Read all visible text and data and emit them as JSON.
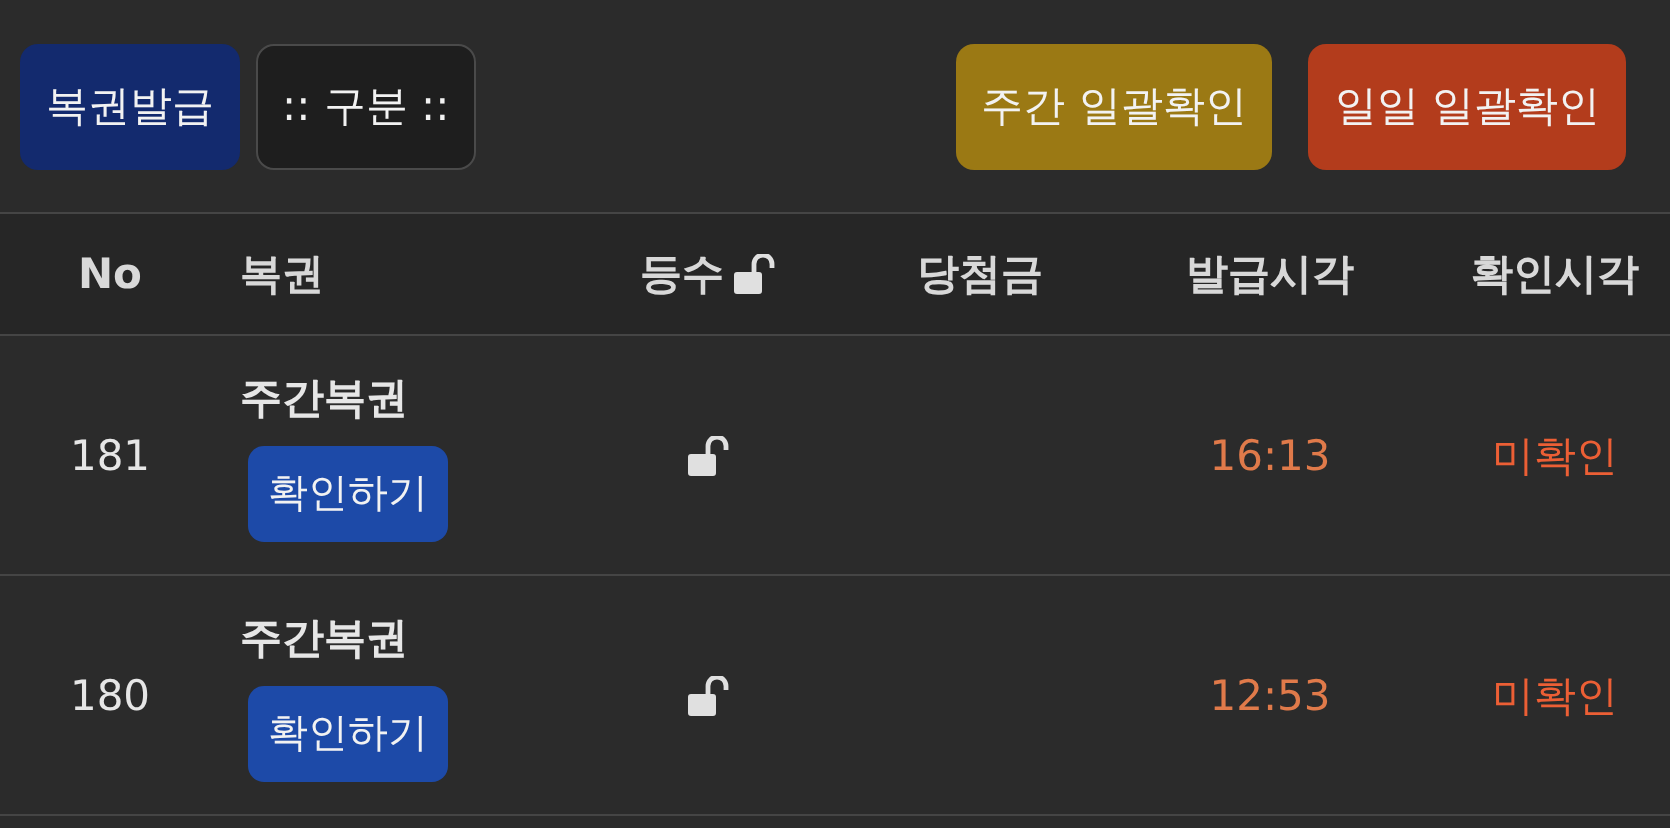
{
  "toolbar": {
    "left": [
      {
        "label": "복권발급",
        "kind": "primary"
      },
      {
        "label": ":: 구분 ::",
        "kind": "outline"
      }
    ],
    "right": [
      {
        "label": "주간 일괄확인",
        "kind": "weekly"
      },
      {
        "label": "일일 일괄확인",
        "kind": "daily"
      }
    ]
  },
  "table": {
    "columns": [
      {
        "label": "No",
        "kind": "no"
      },
      {
        "label": "복권",
        "kind": "ticket"
      },
      {
        "label": "등수",
        "kind": "rank"
      },
      {
        "label": "당첨금",
        "kind": "prize"
      },
      {
        "label": "발급시각",
        "kind": "issued"
      },
      {
        "label": "확인시각",
        "kind": "checked"
      }
    ],
    "rows": [
      {
        "no": "181",
        "ticket": "주간복권",
        "action": "확인하기",
        "issued": "16:13",
        "checked": "미확인"
      },
      {
        "no": "180",
        "ticket": "주간복권",
        "action": "확인하기",
        "issued": "12:53",
        "checked": "미확인"
      }
    ]
  }
}
